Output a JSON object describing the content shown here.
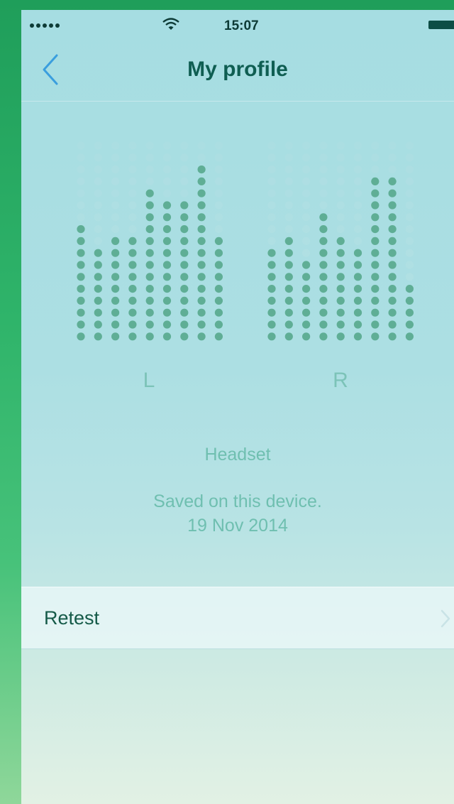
{
  "status_bar": {
    "time": "15:07",
    "signal_dots": 5
  },
  "nav": {
    "title": "My profile",
    "back_icon": "chevron-left-icon"
  },
  "hearing_profile": {
    "left": {
      "label": "L",
      "levels": [
        10,
        8,
        9,
        9,
        13,
        12,
        12,
        15,
        9
      ]
    },
    "right": {
      "label": "R",
      "levels": [
        8,
        9,
        7,
        11,
        9,
        8,
        14,
        14,
        5
      ]
    },
    "max_level": 17
  },
  "device": {
    "name": "Headset",
    "saved_text": "Saved on this device.",
    "saved_date": "19 Nov 2014"
  },
  "retest": {
    "label": "Retest",
    "icon": "chevron-right-icon"
  },
  "colors": {
    "accent": "#3a9ede",
    "title": "#0f5e52",
    "dot_filled": "#5fae95",
    "dot_empty": "#b3e0e3"
  }
}
